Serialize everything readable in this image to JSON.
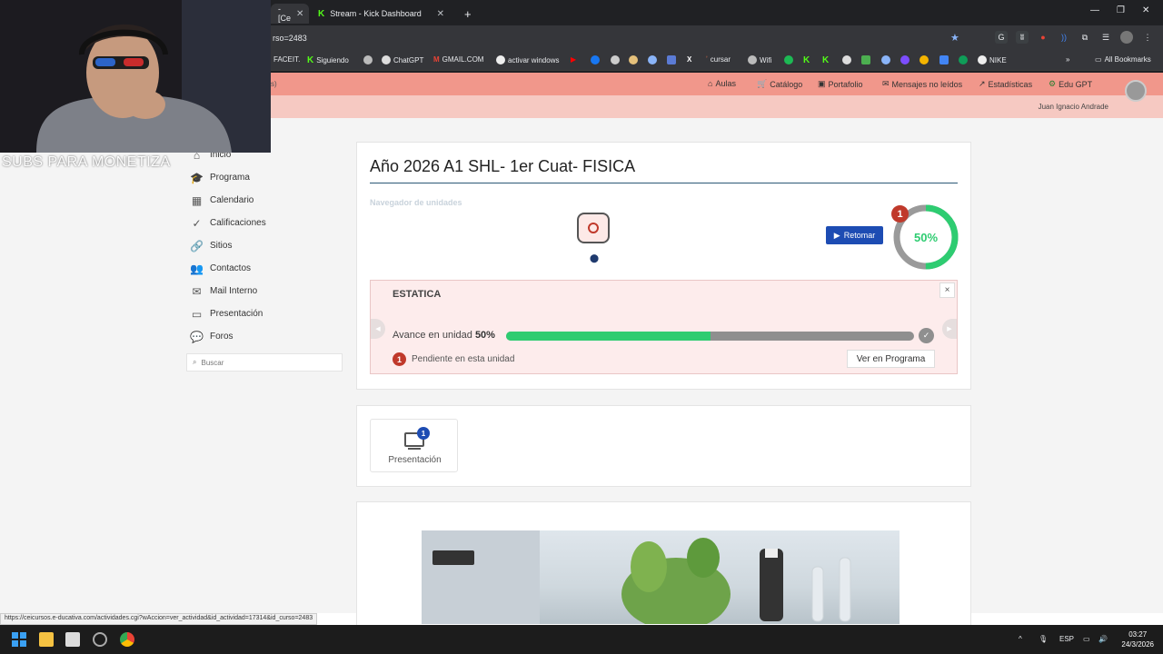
{
  "browser": {
    "tabs": [
      {
        "label": "- [Ce",
        "active": true
      },
      {
        "label": "Stream - Kick Dashboard",
        "active": false
      }
    ],
    "new_tab": "+",
    "url": "rso=2483",
    "bookmarks": [
      "FACEIT.",
      "Siguiendo",
      "ChatGPT",
      "GMAIL.COM",
      "activar windows",
      "cursar",
      "Wifi",
      "NIKE",
      "All Bookmarks"
    ],
    "more_bookmarks": "»"
  },
  "site": {
    "top_left_fragment": "s)",
    "nav": [
      "Aulas",
      "Catálogo",
      "Portafolio",
      "Mensajes no leídos",
      "Estadísticas",
      "Edu GPT"
    ],
    "user_name": "Juan Ignacio Andrade"
  },
  "sidebar": {
    "items": [
      {
        "label": "Inicio",
        "icon": "home-icon"
      },
      {
        "label": "Programa",
        "icon": "graduation-cap-icon"
      },
      {
        "label": "Calendario",
        "icon": "calendar-icon"
      },
      {
        "label": "Calificaciones",
        "icon": "check-circle-icon"
      },
      {
        "label": "Sitios",
        "icon": "link-icon"
      },
      {
        "label": "Contactos",
        "icon": "users-icon"
      },
      {
        "label": "Mail Interno",
        "icon": "mail-icon"
      },
      {
        "label": "Presentación",
        "icon": "monitor-icon"
      },
      {
        "label": "Foros",
        "icon": "comments-icon"
      }
    ],
    "search_placeholder": "Buscar"
  },
  "course": {
    "title": "Año 2026 A1 SHL- 1er Cuat- FISICA",
    "unit_navigator_label": "Navegador de unidades",
    "retomar_label": "Retomar",
    "pending_count": "1",
    "progress_percent": 50,
    "progress_label": "50%",
    "unit": {
      "name": "ESTATICA",
      "avance_label": "Avance en unidad",
      "avance_value": "50%",
      "avance_fraction": 0.5,
      "pending_badge": "1",
      "pending_text": "Pendiente en esta unidad",
      "ver_button": "Ver en Programa",
      "close": "×"
    }
  },
  "resources": {
    "tile_label": "Presentación",
    "tile_badge": "1"
  },
  "webcam": {
    "caption": "SUBS PARA MONETIZA"
  },
  "status_bar_url": "https://ceicursos.e-ducativa.com/actividades.cgi?wAccion=ver_actividad&id_actividad=17314&id_curso=2483",
  "taskbar": {
    "language": "ESP",
    "time": "03:27",
    "date": "24/3/2026"
  },
  "colors": {
    "topbar": "#f1978b",
    "accent_blue": "#1d4cb3",
    "progress_green": "#2ecc71",
    "badge_red": "#c0392b"
  }
}
